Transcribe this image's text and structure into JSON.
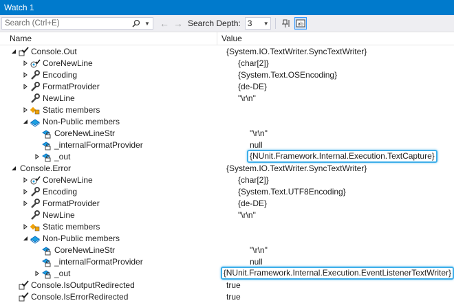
{
  "window": {
    "title": "Watch 1"
  },
  "toolbar": {
    "search_placeholder": "Search (Ctrl+E)",
    "search_depth_label": "Search Depth:",
    "search_depth_value": "3"
  },
  "columns": {
    "name": "Name",
    "value": "Value"
  },
  "rows": [
    {
      "indent": 0,
      "expander": "expanded",
      "icon": "field-static",
      "name": "Console.Out",
      "value": "{System.IO.TextWriter.SyncTextWriter}",
      "hl": false
    },
    {
      "indent": 1,
      "expander": "collapsed",
      "icon": "property-gear",
      "name": "CoreNewLine",
      "value": "{char[2]}",
      "hl": false
    },
    {
      "indent": 1,
      "expander": "collapsed",
      "icon": "wrench",
      "name": "Encoding",
      "value": "{System.Text.OSEncoding}",
      "hl": false
    },
    {
      "indent": 1,
      "expander": "collapsed",
      "icon": "wrench",
      "name": "FormatProvider",
      "value": "{de-DE}",
      "hl": false
    },
    {
      "indent": 1,
      "expander": "none",
      "icon": "wrench",
      "name": "NewLine",
      "value": "\"\\r\\n\"",
      "hl": false
    },
    {
      "indent": 1,
      "expander": "collapsed",
      "icon": "static-members",
      "name": "Static members",
      "value": "",
      "hl": false
    },
    {
      "indent": 1,
      "expander": "expanded",
      "icon": "nonpublic",
      "name": "Non-Public members",
      "value": "",
      "hl": false
    },
    {
      "indent": 2,
      "expander": "none",
      "icon": "field-lock",
      "name": "CoreNewLineStr",
      "value": "\"\\r\\n\"",
      "hl": false
    },
    {
      "indent": 2,
      "expander": "none",
      "icon": "field-lock",
      "name": "_internalFormatProvider",
      "value": "null",
      "hl": false
    },
    {
      "indent": 2,
      "expander": "collapsed",
      "icon": "field-lock",
      "name": "_out",
      "value": "{NUnit.Framework.Internal.Execution.TextCapture}",
      "hl": true
    },
    {
      "indent": 0,
      "expander": "expanded",
      "icon": "none",
      "name": "Console.Error",
      "value": "{System.IO.TextWriter.SyncTextWriter}",
      "hl": false
    },
    {
      "indent": 1,
      "expander": "collapsed",
      "icon": "property-gear",
      "name": "CoreNewLine",
      "value": "{char[2]}",
      "hl": false
    },
    {
      "indent": 1,
      "expander": "collapsed",
      "icon": "wrench",
      "name": "Encoding",
      "value": "{System.Text.UTF8Encoding}",
      "hl": false
    },
    {
      "indent": 1,
      "expander": "collapsed",
      "icon": "wrench",
      "name": "FormatProvider",
      "value": "{de-DE}",
      "hl": false
    },
    {
      "indent": 1,
      "expander": "none",
      "icon": "wrench",
      "name": "NewLine",
      "value": "\"\\r\\n\"",
      "hl": false
    },
    {
      "indent": 1,
      "expander": "collapsed",
      "icon": "static-members",
      "name": "Static members",
      "value": "",
      "hl": false
    },
    {
      "indent": 1,
      "expander": "expanded",
      "icon": "nonpublic",
      "name": "Non-Public members",
      "value": "",
      "hl": false
    },
    {
      "indent": 2,
      "expander": "none",
      "icon": "field-lock",
      "name": "CoreNewLineStr",
      "value": "\"\\r\\n\"",
      "hl": false
    },
    {
      "indent": 2,
      "expander": "none",
      "icon": "field-lock",
      "name": "_internalFormatProvider",
      "value": "null",
      "hl": false
    },
    {
      "indent": 2,
      "expander": "collapsed",
      "icon": "field-lock",
      "name": "_out",
      "value": "{NUnit.Framework.Internal.Execution.EventListenerTextWriter}",
      "hl": true
    },
    {
      "indent": 0,
      "expander": "none",
      "icon": "field-static",
      "name": "Console.IsOutputRedirected",
      "value": "true",
      "hl": false
    },
    {
      "indent": 0,
      "expander": "none",
      "icon": "field-static",
      "name": "Console.IsErrorRedirected",
      "value": "true",
      "hl": false
    }
  ]
}
